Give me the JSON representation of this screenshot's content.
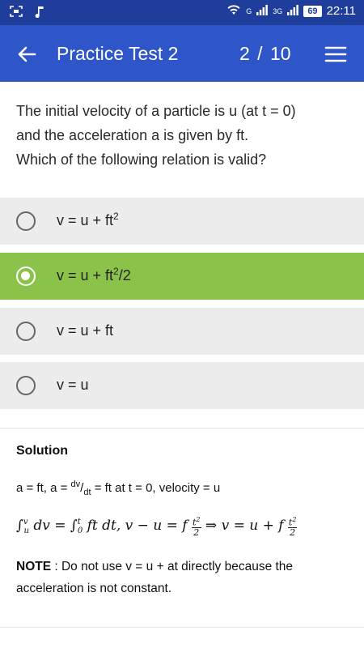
{
  "status_bar": {
    "network_1": "G",
    "network_2": "3G",
    "battery": "69",
    "time": "22:11"
  },
  "app_bar": {
    "title": "Practice Test 2",
    "counter": "2  / 10"
  },
  "question": {
    "line1": "The initial velocity of a particle is u (at t = 0)",
    "line2": "and the acceleration a is given by ft.",
    "line3": "Which of the following relation is valid?"
  },
  "options": [
    {
      "base": "v = u + ft",
      "sup": "2",
      "tail": "",
      "selected": false
    },
    {
      "base": "v = u + ft",
      "sup": "2",
      "tail": "/2",
      "selected": true
    },
    {
      "base": "v = u + ft",
      "sup": "",
      "tail": "",
      "selected": false
    },
    {
      "base": "v = u",
      "sup": "",
      "tail": "",
      "selected": false
    }
  ],
  "solution": {
    "heading": "Solution",
    "line1_a": "a = ft, a = ",
    "line1_dv": "dv",
    "line1_slash": "/",
    "line1_dt": "dt",
    "line1_b": " = ft at t = 0, velocity = u",
    "note_label": "NOTE",
    "note_text": " : Do not use v = u + at directly because the acceleration is not constant."
  },
  "colors": {
    "status_bar": "#1f3e9c",
    "app_bar": "#2f56c8",
    "selected_option": "#8bc34a",
    "option_bg": "#ececec"
  },
  "icons": {
    "back": "arrow-left-icon",
    "menu": "hamburger-menu-icon"
  }
}
